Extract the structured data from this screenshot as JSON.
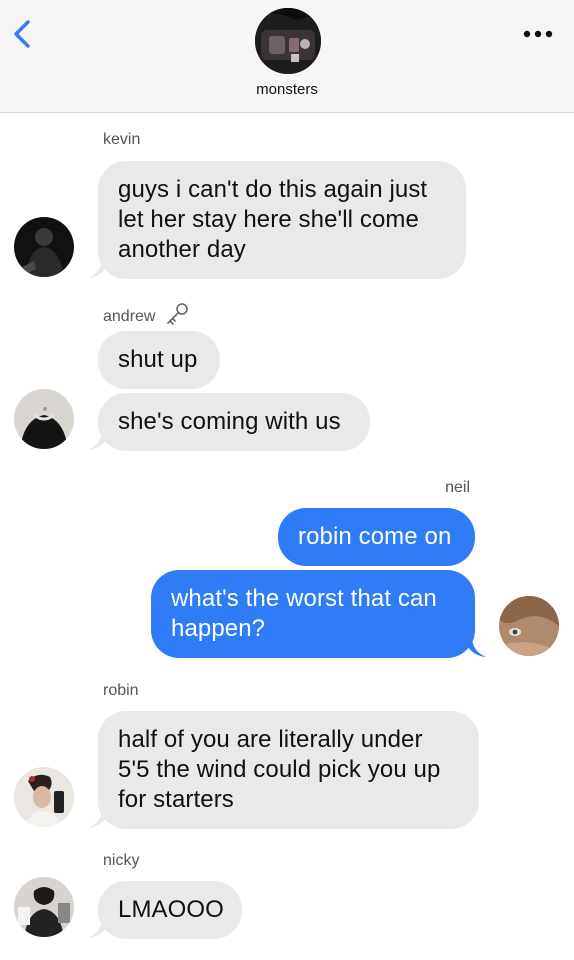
{
  "header": {
    "group_name": "monsters",
    "back_icon": "chevron-left-icon",
    "more_icon": "ellipsis-icon",
    "accent_color": "#2f7cf6"
  },
  "messages": [
    {
      "sender": "kevin",
      "direction": "incoming",
      "text": "guys i can't do this again just let her stay here she'll come another day"
    },
    {
      "sender": "andrew",
      "sender_icon": "key-icon",
      "direction": "incoming",
      "text": "shut up"
    },
    {
      "sender": "andrew",
      "direction": "incoming",
      "text": "she's coming with us"
    },
    {
      "sender": "neil",
      "direction": "outgoing",
      "text": "robin come on"
    },
    {
      "sender": "neil",
      "direction": "outgoing",
      "text": "what's the worst that can happen?"
    },
    {
      "sender": "robin",
      "direction": "incoming",
      "text": "half of you are literally under 5'5 the wind could pick you up for starters"
    },
    {
      "sender": "nicky",
      "direction": "incoming",
      "text": "LMAOOO"
    }
  ],
  "colors": {
    "incoming_bubble": "#e9e9eb",
    "outgoing_bubble": "#2f7cf6"
  }
}
